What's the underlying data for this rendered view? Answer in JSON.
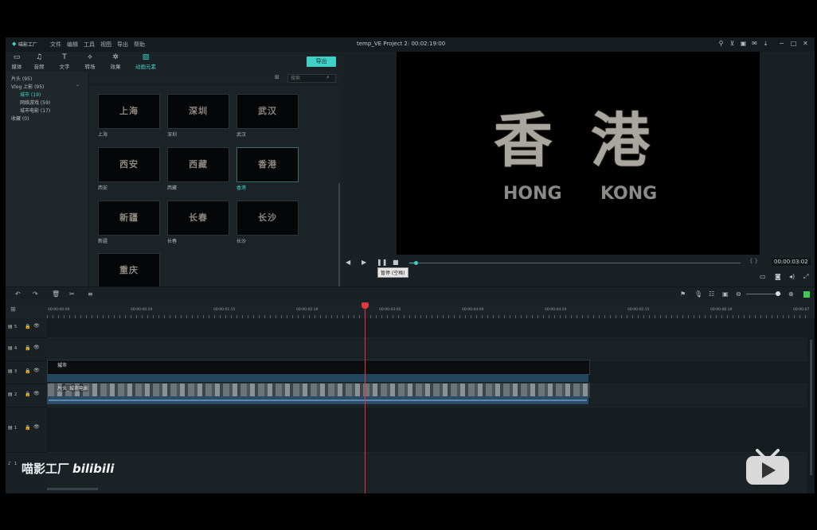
{
  "app": {
    "logo_text": "喵影工厂",
    "title": "temp_VE Project 2:  00:02:19:00"
  },
  "menu": [
    "文件",
    "编辑",
    "工具",
    "视图",
    "导出",
    "帮助"
  ],
  "tabs": [
    {
      "label": "媒体",
      "icon": "folder-icon"
    },
    {
      "label": "音频",
      "icon": "music-icon"
    },
    {
      "label": "文字",
      "icon": "text-icon"
    },
    {
      "label": "转场",
      "icon": "transition-icon"
    },
    {
      "label": "效果",
      "icon": "effects-icon"
    },
    {
      "label": "动画元素",
      "icon": "elements-icon"
    }
  ],
  "export_label": "导出",
  "tree": [
    {
      "label": "片头 (95)"
    },
    {
      "label": "Vlog 上影 (95)"
    },
    {
      "label": "城市 (19)"
    },
    {
      "label": "网络游戏 (59)"
    },
    {
      "label": "城市电影 (17)"
    },
    {
      "label": "收藏 (0)"
    }
  ],
  "search": {
    "placeholder": "搜索"
  },
  "thumbs": [
    {
      "text": "上海",
      "caption": "上海"
    },
    {
      "text": "深圳",
      "caption": "深圳"
    },
    {
      "text": "武汉",
      "caption": "武汉"
    },
    {
      "text": "西安",
      "caption": "西安"
    },
    {
      "text": "西藏",
      "caption": "西藏"
    },
    {
      "text": "香港",
      "caption": "香港"
    },
    {
      "text": "新疆",
      "caption": "新疆"
    },
    {
      "text": "长春",
      "caption": "长春"
    },
    {
      "text": "长沙",
      "caption": "长沙"
    },
    {
      "text": "重庆",
      "caption": ""
    }
  ],
  "preview": {
    "cjk_1": "香",
    "cjk_2": "港",
    "lat_1": "HONG",
    "lat_2": "KONG"
  },
  "playback": {
    "timecode": "00:00:03:02",
    "tooltip": "暂停 (空格)",
    "progress": 0.02
  },
  "ruler_labels": [
    "00:00:00:00",
    "00:00:00:20",
    "00:00:01:15",
    "00:00:02:10",
    "00:00:03:05",
    "00:00:04:00",
    "00:00:04:20",
    "00:00:05:15",
    "00:00:06:10",
    "00:00:07"
  ],
  "tracks": [
    {
      "label": "5"
    },
    {
      "label": "4"
    },
    {
      "label": "3"
    },
    {
      "label": "2"
    },
    {
      "label": "1"
    },
    {
      "label": "1"
    }
  ],
  "clips": {
    "title_clip": "城市",
    "video_clip": "片头_城市电影"
  },
  "watermark": {
    "text": "喵影工厂",
    "bili": "bilibili"
  },
  "colors": {
    "accent": "#3fd1c7",
    "playhead": "#e0383e"
  }
}
